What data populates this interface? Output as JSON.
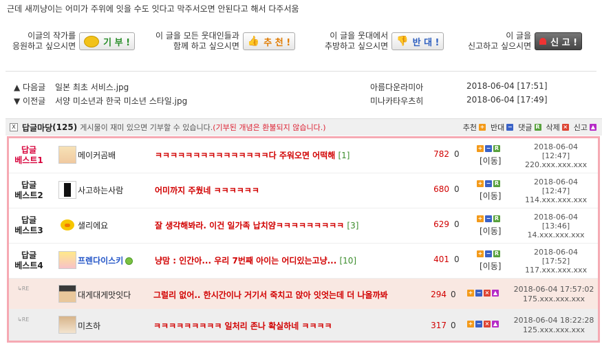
{
  "post_tail_text": "근데 새끼냥이는 어미가 주위에 잇을 수도 잇다고 막주서오면 안된다고 해서 다주서움",
  "vote": {
    "donate_label_1": "이글의 작가를",
    "donate_label_2": "응원하고 싶으시면",
    "donate_button": "기 부 !",
    "recommend_label_1": "이 글을 모든 웃대인들과",
    "recommend_label_2": "함께 하고 싶으시면",
    "recommend_button": "추 천 !",
    "oppose_label_1": "이 글을 웃대에서",
    "oppose_label_2": "추방하고 싶으시면",
    "oppose_button": "반 대 !",
    "report_label_1": "이 글을",
    "report_label_2": "신고하고 싶으시면",
    "report_button": "신 고 !"
  },
  "nav": [
    {
      "dir": "▲ 다음글",
      "title": "일본 최초 서비스.jpg",
      "author": "아름다운라미아",
      "date": "2018-06-04 [17:51]"
    },
    {
      "dir": "▼ 이전글",
      "title": "서양 미소년과 한국 미소년 스타일.jpg",
      "author": "미나카타우츠히",
      "date": "2018-06-04 [17:49]"
    }
  ],
  "comments_header": {
    "expand": "X",
    "title": "답글마당",
    "count": "(125)",
    "desc": "게시물이 재미 있으면 기부할 수 있습니다.",
    "note": "(기부된 개념은 환불되지 않습니다.)",
    "stats": [
      "추천",
      "반대",
      "댓글",
      "삭제",
      "신고"
    ]
  },
  "comments": [
    {
      "best1": "답글",
      "best2": "베스트1",
      "nick": "메이커곰배",
      "text": "ㅋㅋㅋㅋㅋㅋㅋㅋㅋㅋㅋㅋㅋㅋㅋ다 주워오면 어떡해",
      "count": "[1]",
      "likes": "782",
      "zero": "0",
      "move": "[이동]",
      "date1": "2018-06-04",
      "date2": "[12:47]",
      "ip": "220.xxx.xxx.xxx"
    },
    {
      "best1": "답글",
      "best2": "베스트2",
      "nick": "사고하는사람",
      "text": "어미까지 주웠네 ㅋㅋㅋㅋㅋㅋ",
      "count": "",
      "likes": "680",
      "zero": "0",
      "move": "[이동]",
      "date1": "2018-06-04",
      "date2": "[12:47]",
      "ip": "114.xxx.xxx.xxx"
    },
    {
      "best1": "답글",
      "best2": "베스트3",
      "nick": "샐리에요",
      "text": "잘 생각해봐라. 이건 일가족 납치얌ㅋㅋㅋㅋㅋㅋㅋㅋㅋ",
      "count": "[3]",
      "likes": "629",
      "zero": "0",
      "move": "[이동]",
      "date1": "2018-06-04",
      "date2": "[13:46]",
      "ip": "14.xxx.xxx.xxx"
    },
    {
      "best1": "답글",
      "best2": "베스트4",
      "nick": "프렌다이스키",
      "text": "냥맘 : 인간아... 우리 7번째 아이는 어디있는고냥...",
      "count": "[10]",
      "likes": "401",
      "zero": "0",
      "move": "[이동]",
      "date1": "2018-06-04",
      "date2": "[17:52]",
      "ip": "117.xxx.xxx.xxx"
    }
  ],
  "replies": [
    {
      "re": "RE",
      "nick": "대게대게맛잇다",
      "text": "그럴리 없어.. 한시간이나 거기서 죽치고 앉아 잇엇는데 더 나올까봐",
      "likes": "294",
      "zero": "0",
      "date": "2018-06-04 17:57:02",
      "ip": "175.xxx.xxx.xxx"
    },
    {
      "re": "RE",
      "nick": "미츠하",
      "text": "ㅋㅋㅋㅋㅋㅋㅋㅋㅋ 일처리 존나 확실하네 ㅋㅋㅋㅋ",
      "likes": "317",
      "zero": "0",
      "date": "2018-06-04 18:22:28",
      "ip": "125.xxx.xxx.xxx"
    }
  ],
  "colors": {
    "best_red": "#d7003a",
    "comment_red": "#d10000",
    "border_pink": "#f6a9b3",
    "reply_bg": "#f9e8e2"
  },
  "icons": [
    "coin-icon",
    "thumbs-up-icon",
    "thumbs-down-icon",
    "siren-icon"
  ]
}
